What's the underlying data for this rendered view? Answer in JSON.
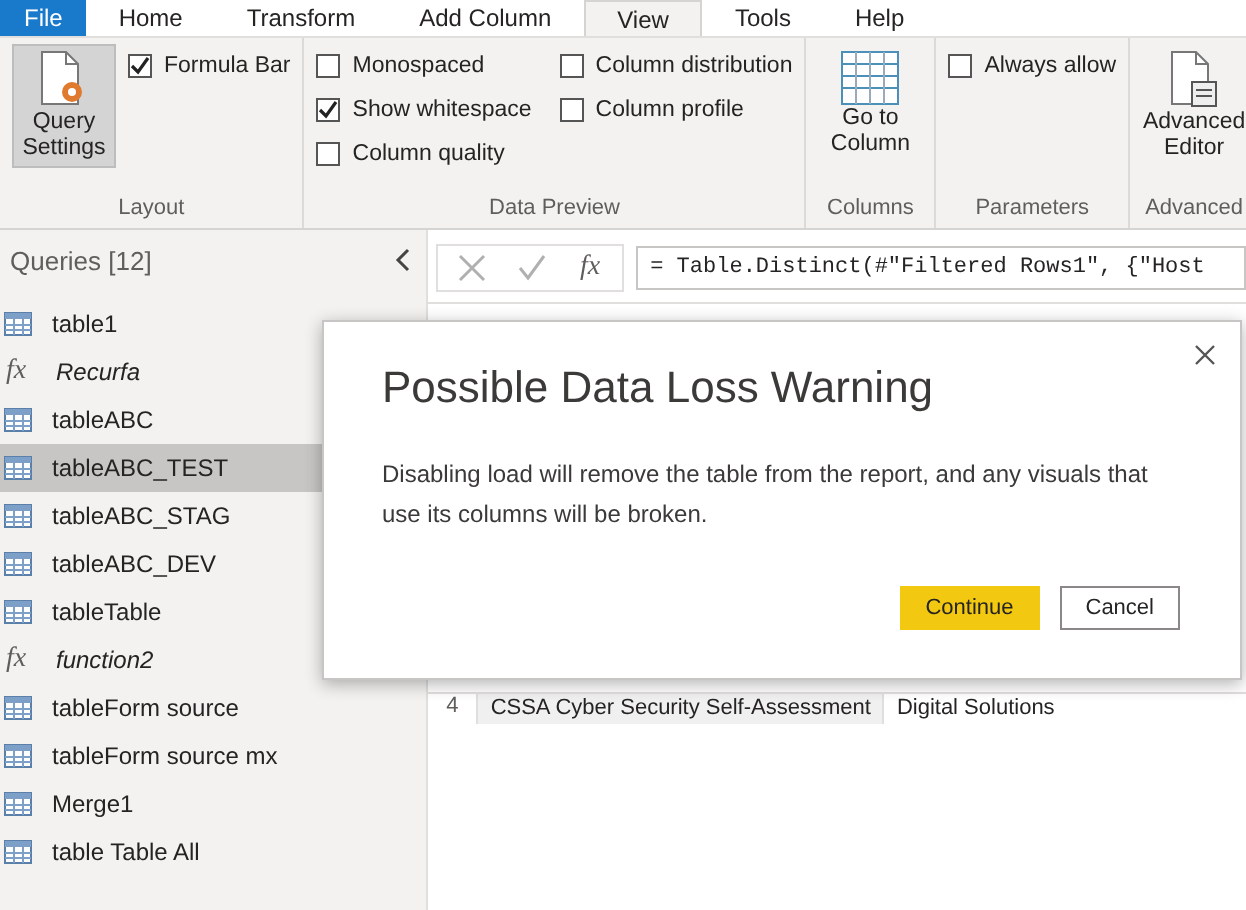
{
  "ribbon": {
    "tabs": [
      {
        "label": "File",
        "kind": "file",
        "selected": false
      },
      {
        "label": "Home",
        "kind": "tab",
        "selected": false
      },
      {
        "label": "Transform",
        "kind": "tab",
        "selected": false
      },
      {
        "label": "Add Column",
        "kind": "tab",
        "selected": false
      },
      {
        "label": "View",
        "kind": "tab",
        "selected": true
      },
      {
        "label": "Tools",
        "kind": "tab",
        "selected": false
      },
      {
        "label": "Help",
        "kind": "tab",
        "selected": false
      }
    ],
    "groups": [
      {
        "label": "Layout",
        "items": [
          {
            "kind": "settings",
            "label": "Query Settings",
            "pressed": true
          },
          {
            "kind": "checkbox",
            "label": "Formula Bar",
            "checked": true
          }
        ]
      },
      {
        "label": "Data Preview",
        "items": [
          {
            "kind": "checkbox",
            "label": "Monospaced",
            "checked": false
          },
          {
            "kind": "checkbox",
            "label": "Show whitespace",
            "checked": true
          },
          {
            "kind": "checkbox",
            "label": "Column quality",
            "checked": false
          },
          {
            "kind": "checkbox",
            "label": "Column distribution",
            "checked": false
          },
          {
            "kind": "checkbox",
            "label": "Column profile",
            "checked": false
          }
        ]
      },
      {
        "label": "Columns",
        "items": [
          {
            "kind": "columns",
            "label": "Go to Column",
            "pressed": false
          }
        ]
      },
      {
        "label": "Parameters",
        "items": [
          {
            "kind": "checkbox",
            "label": "Always allow",
            "checked": false
          }
        ]
      },
      {
        "label": "Advanced",
        "items": [
          {
            "kind": "editor",
            "label": "Advanced Editor",
            "pressed": false
          }
        ]
      }
    ]
  },
  "queries": {
    "title": "Queries [12]",
    "items": [
      {
        "label": "table1",
        "kind": "table",
        "selected": false
      },
      {
        "label": "Recurfa",
        "kind": "function",
        "icon": "fx",
        "selected": false
      },
      {
        "label": "tableABC",
        "kind": "table",
        "selected": false
      },
      {
        "label": "tableABC_TEST",
        "kind": "table",
        "selected": true
      },
      {
        "label": "tableABC_STAG",
        "kind": "table",
        "selected": false
      },
      {
        "label": "tableABC_DEV",
        "kind": "table",
        "selected": false
      },
      {
        "label": "tableTable",
        "kind": "table",
        "selected": false
      },
      {
        "label": "function2",
        "kind": "function",
        "icon": "fx",
        "selected": false
      },
      {
        "label": "tableForm source",
        "kind": "table",
        "selected": false
      },
      {
        "label": "tableForm source mx",
        "kind": "table",
        "selected": false
      },
      {
        "label": "Merge1",
        "kind": "table",
        "selected": false
      },
      {
        "label": "table Table All",
        "kind": "table",
        "selected": false
      }
    ]
  },
  "formula_bar": {
    "fx_label": "fx",
    "value": "= Table.Distinct(#\"Filtered Rows1\", {\"Host"
  },
  "grid": {
    "rows": [
      {
        "index": "4",
        "cells": [
          "CSSA Cyber Security Self-Assessment",
          "Digital Solutions"
        ]
      }
    ]
  },
  "dialog": {
    "title": "Possible Data Loss Warning",
    "message": "Disabling load will remove the table from the report, and any visuals that use its columns will be broken.",
    "buttons": [
      {
        "label": "Continue",
        "kind": "primary"
      },
      {
        "label": "Cancel",
        "kind": "secondary"
      }
    ]
  }
}
